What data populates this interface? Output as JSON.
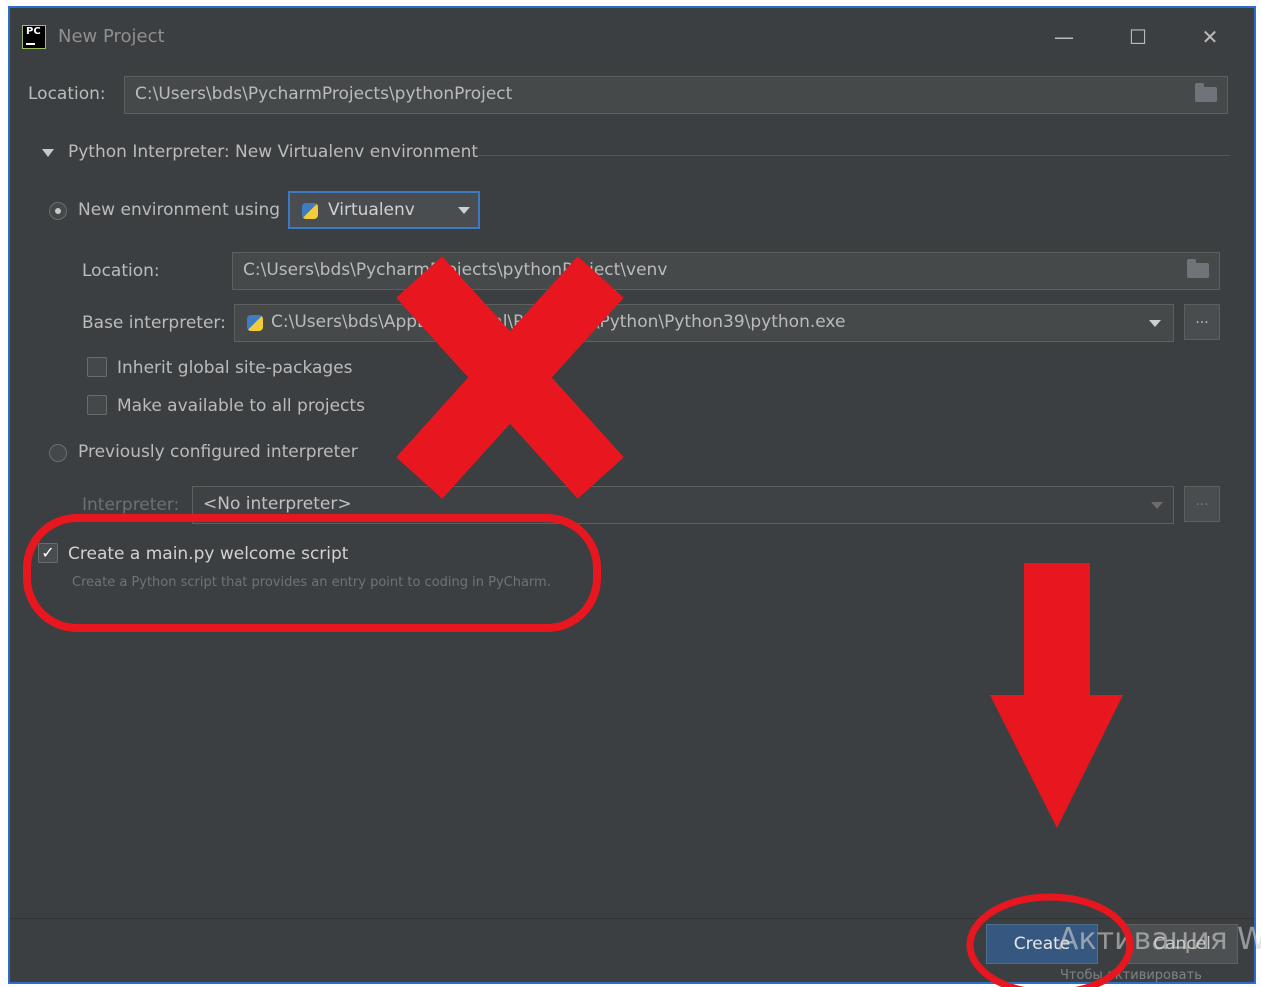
{
  "window": {
    "title": "New Project",
    "app_icon_text": "PC",
    "minimize_glyph": "—",
    "maximize_glyph": "☐",
    "close_glyph": "✕"
  },
  "location": {
    "label": "Location:",
    "value": "C:\\Users\\bds\\PycharmProjects\\pythonProject"
  },
  "interpreter_section": {
    "header": "Python Interpreter: New Virtualenv environment",
    "new_env": {
      "label": "New environment using",
      "selected": true,
      "tool": "Virtualenv",
      "location_label": "Location:",
      "location_value": "C:\\Users\\bds\\PycharmProjects\\pythonProject\\venv",
      "base_label": "Base interpreter:",
      "base_value": "C:\\Users\\bds\\AppData\\Local\\Programs\\Python\\Python39\\python.exe",
      "inherit_label": "Inherit global site-packages",
      "inherit_checked": false,
      "available_label": "Make available to all projects",
      "available_checked": false
    },
    "previous": {
      "label": "Previously configured interpreter",
      "selected": false,
      "interpreter_label": "Interpreter:",
      "interpreter_value": "<No interpreter>"
    }
  },
  "welcome_script": {
    "label": "Create a main.py welcome script",
    "checked": true,
    "hint": "Create a Python script that provides an entry point to coding in PyCharm."
  },
  "buttons": {
    "create": "Create",
    "cancel": "Cancel",
    "ellipsis": "..."
  },
  "watermark": {
    "line1": "Активация Wi",
    "line2": "Чтобы активировать"
  },
  "annotation_colors": {
    "red": "#e8161f",
    "accent_blue": "#3d79c5"
  }
}
